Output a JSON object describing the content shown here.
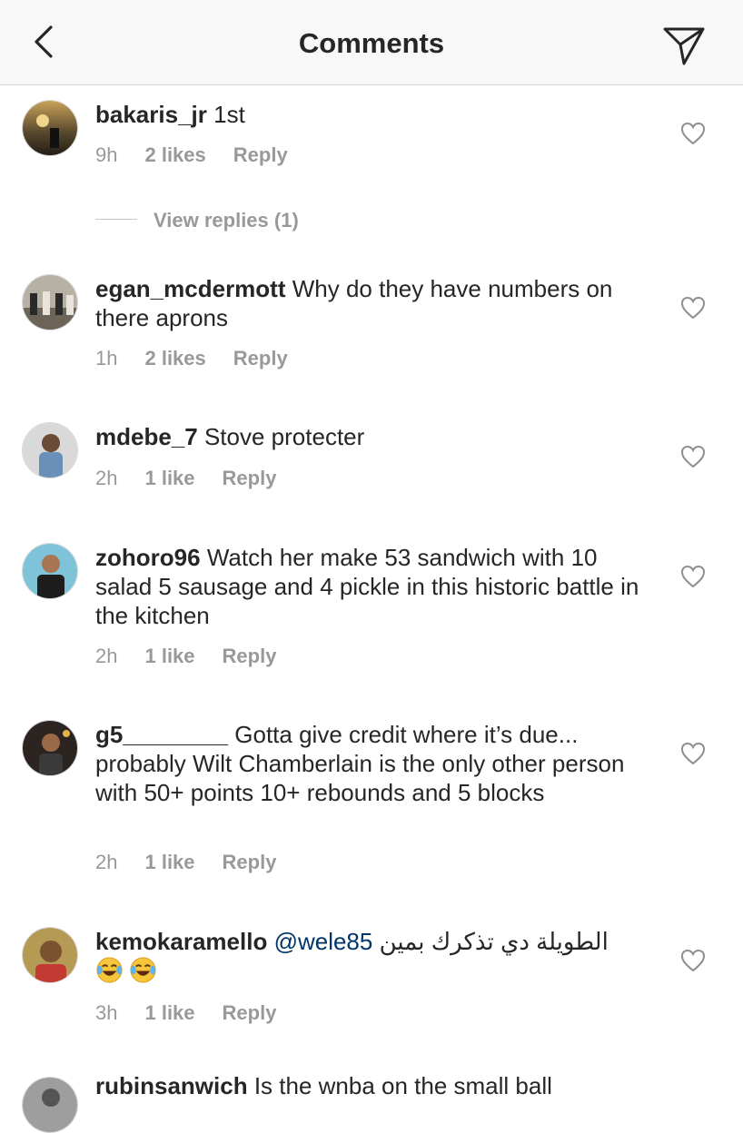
{
  "header": {
    "title": "Comments",
    "back_icon": "chevron-left-icon",
    "send_icon": "paper-plane-icon"
  },
  "comments": [
    {
      "username": "bakaris_jr",
      "text": "1st",
      "time": "9h",
      "likes": "2 likes",
      "reply": "Reply",
      "view_replies": "View replies (1)"
    },
    {
      "username": "egan_mcdermott",
      "text": "Why do they have numbers on there aprons",
      "time": "1h",
      "likes": "2 likes",
      "reply": "Reply"
    },
    {
      "username": "mdebe_7",
      "text": "Stove protecter",
      "time": "2h",
      "likes": "1 like",
      "reply": "Reply"
    },
    {
      "username": "zohoro96",
      "text": "Watch her make 53 sandwich with 10 salad 5 sausage and 4 pickle in this historic battle in the kitchen",
      "time": "2h",
      "likes": "1 like",
      "reply": "Reply"
    },
    {
      "username": "g5________",
      "text": "Gotta give credit where it’s due... probably Wilt Chamberlain is the only other person with 50+ points 10+ rebounds and 5 blocks",
      "time": "2h",
      "likes": "1 like",
      "reply": "Reply"
    },
    {
      "username": "kemokaramello",
      "mention": "@wele85",
      "text": "الطويلة دي تذكرك بمين",
      "emoji": "😂😂",
      "time": "3h",
      "likes": "1 like",
      "reply": "Reply"
    },
    {
      "username": "rubinsanwich",
      "text": "Is the wnba on the small ball"
    }
  ],
  "colors": {
    "meta": "#999999",
    "mention": "#003569",
    "header_bg": "#f8f8f8"
  }
}
